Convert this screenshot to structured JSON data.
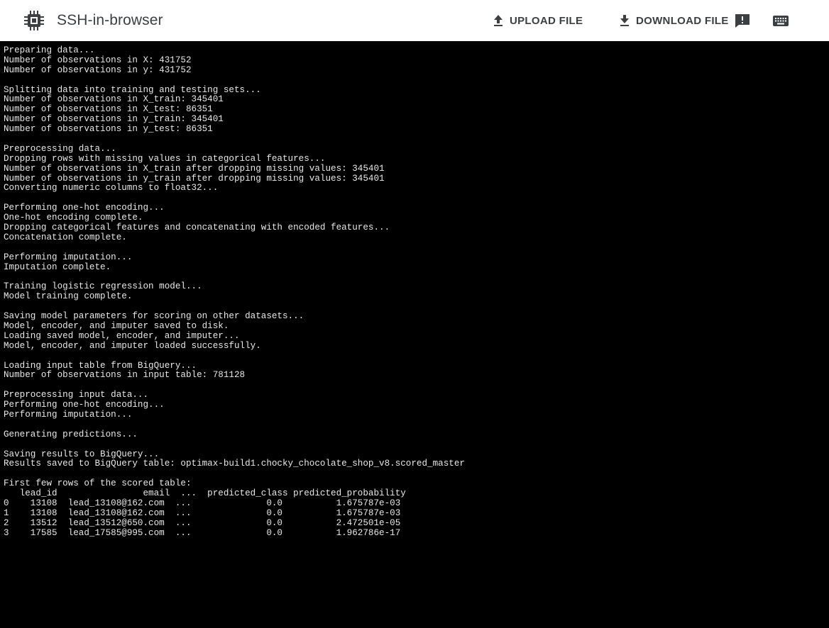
{
  "header": {
    "app_title": "SSH-in-browser",
    "upload_label": "UPLOAD FILE",
    "download_label": "DOWNLOAD FILE",
    "icons": {
      "app": "chip-icon",
      "upload": "upload-icon",
      "download": "download-icon",
      "feedback": "feedback-icon",
      "keyboard": "keyboard-icon"
    }
  },
  "colors": {
    "terminal_bg": "#000000",
    "terminal_fg": "#e8e8e8",
    "header_text": "#3c4043"
  },
  "terminal": {
    "lines": [
      "Preparing data...",
      "Number of observations in X: 431752",
      "Number of observations in y: 431752",
      "",
      "Splitting data into training and testing sets...",
      "Number of observations in X_train: 345401",
      "Number of observations in X_test: 86351",
      "Number of observations in y_train: 345401",
      "Number of observations in y_test: 86351",
      "",
      "Preprocessing data...",
      "Dropping rows with missing values in categorical features...",
      "Number of observations in X_train after dropping missing values: 345401",
      "Number of observations in y_train after dropping missing values: 345401",
      "Converting numeric columns to float32...",
      "",
      "Performing one-hot encoding...",
      "One-hot encoding complete.",
      "Dropping categorical features and concatenating with encoded features...",
      "Concatenation complete.",
      "",
      "Performing imputation...",
      "Imputation complete.",
      "",
      "Training logistic regression model...",
      "Model training complete.",
      "",
      "Saving model parameters for scoring on other datasets...",
      "Model, encoder, and imputer saved to disk.",
      "Loading saved model, encoder, and imputer...",
      "Model, encoder, and imputer loaded successfully.",
      "",
      "Loading input table from BigQuery...",
      "Number of observations in input table: 781128",
      "",
      "Preprocessing input data...",
      "Performing one-hot encoding...",
      "Performing imputation...",
      "",
      "Generating predictions...",
      "",
      "Saving results to BigQuery...",
      "Results saved to BigQuery table: optimax-build1.chocky_chocolate_shop_v8.scored_master",
      "",
      "First few rows of the scored table:",
      "   lead_id                email  ...  predicted_class predicted_probability",
      "0    13108  lead_13108@162.com  ...              0.0          1.675787e-03",
      "1    13108  lead_13108@162.com  ...              0.0          1.675787e-03",
      "2    13512  lead_13512@650.com  ...              0.0          2.472501e-05",
      "3    17585  lead_17585@995.com  ...              0.0          1.962786e-17"
    ]
  }
}
